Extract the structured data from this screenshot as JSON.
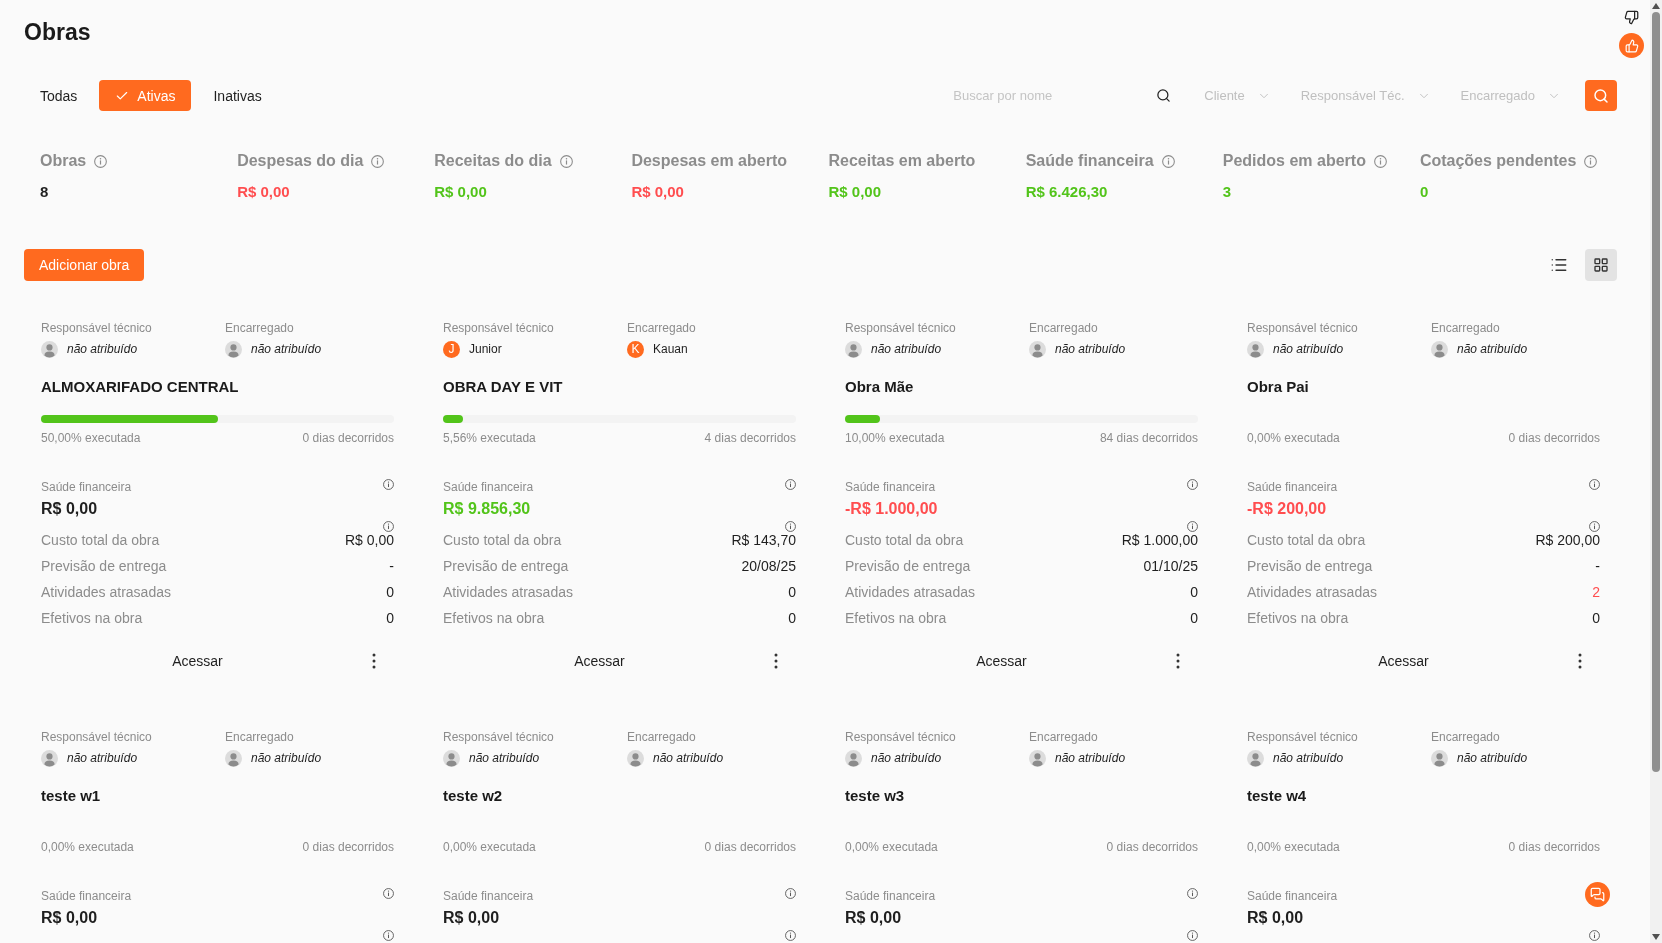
{
  "page": {
    "title": "Obras"
  },
  "tabs": [
    {
      "label": "Todas",
      "selected": false
    },
    {
      "label": "Ativas",
      "selected": true
    },
    {
      "label": "Inativas",
      "selected": false
    }
  ],
  "filters": {
    "search": {
      "placeholder": "Buscar por nome"
    },
    "selects": [
      {
        "placeholder": "Cliente"
      },
      {
        "placeholder": "Responsável Téc."
      },
      {
        "placeholder": "Encarregado"
      }
    ]
  },
  "stats": [
    {
      "label": "Obras",
      "info": true,
      "value": "8",
      "color": "#1f1f1f"
    },
    {
      "label": "Despesas do dia",
      "info": true,
      "value": "R$ 0,00",
      "color": "#ff4d4f"
    },
    {
      "label": "Receitas do dia",
      "info": true,
      "value": "R$ 0,00",
      "color": "#52c41a"
    },
    {
      "label": "Despesas em aberto",
      "info": false,
      "value": "R$ 0,00",
      "color": "#ff4d4f"
    },
    {
      "label": "Receitas em aberto",
      "info": false,
      "value": "R$ 0,00",
      "color": "#52c41a"
    },
    {
      "label": "Saúde financeira",
      "info": true,
      "value": "R$ 6.426,30",
      "color": "#52c41a"
    },
    {
      "label": "Pedidos em aberto",
      "info": true,
      "value": "3",
      "color": "#52c41a"
    },
    {
      "label": "Cotações pendentes",
      "info": true,
      "value": "0",
      "color": "#52c41a"
    }
  ],
  "add_button": "Adicionar obra",
  "view_modes": [
    {
      "kind": "list",
      "selected": false
    },
    {
      "kind": "grid",
      "selected": true
    }
  ],
  "cards": [
    {
      "responsible": {
        "label": "Responsável técnico",
        "kind": "none",
        "name": "não atribuído"
      },
      "foreman": {
        "label": "Encarregado",
        "kind": "none",
        "name": "não atribuído"
      },
      "title": "ALMOXARIFADO CENTRAL",
      "progress": {
        "level": 0.5,
        "label": "50,00% executada"
      },
      "elapsed": "0 dias decorridos",
      "health": {
        "label": "Saúde financeira",
        "info": true,
        "value": "R$ 0,00",
        "color": "#1f1f1f"
      },
      "details": [
        {
          "label": "Custo total da obra",
          "value": "R$ 0,00",
          "color": "#1f1f1f"
        },
        {
          "label": "Previsão de entrega",
          "value": "-",
          "color": "#1f1f1f"
        },
        {
          "label": "Atividades atrasadas",
          "value": "0",
          "color": "#1f1f1f"
        },
        {
          "label": "Efetivos na obra",
          "value": "0",
          "color": "#1f1f1f"
        }
      ],
      "action": "Acessar"
    },
    {
      "responsible": {
        "label": "Responsável técnico",
        "kind": "user",
        "initial": "J",
        "name": "Junior"
      },
      "foreman": {
        "label": "Encarregado",
        "kind": "user",
        "initial": "K",
        "name": "Kauan"
      },
      "title": "OBRA DAY E VIT",
      "progress": {
        "level": 0.0556,
        "label": "5,56% executada"
      },
      "elapsed": "4 dias decorridos",
      "health": {
        "label": "Saúde financeira",
        "info": true,
        "value": "R$ 9.856,30",
        "color": "#52c41a"
      },
      "details": [
        {
          "label": "Custo total da obra",
          "value": "R$ 143,70",
          "color": "#1f1f1f"
        },
        {
          "label": "Previsão de entrega",
          "value": "20/08/25",
          "color": "#1f1f1f"
        },
        {
          "label": "Atividades atrasadas",
          "value": "0",
          "color": "#1f1f1f"
        },
        {
          "label": "Efetivos na obra",
          "value": "0",
          "color": "#1f1f1f"
        }
      ],
      "action": "Acessar"
    },
    {
      "responsible": {
        "label": "Responsável técnico",
        "kind": "none",
        "name": "não atribuído"
      },
      "foreman": {
        "label": "Encarregado",
        "kind": "none",
        "name": "não atribuído"
      },
      "title": "Obra Mãe",
      "progress": {
        "level": 0.1,
        "label": "10,00% executada"
      },
      "elapsed": "84 dias decorridos",
      "health": {
        "label": "Saúde financeira",
        "info": true,
        "value": "-R$ 1.000,00",
        "color": "#ff4d4f"
      },
      "details": [
        {
          "label": "Custo total da obra",
          "value": "R$ 1.000,00",
          "color": "#1f1f1f"
        },
        {
          "label": "Previsão de entrega",
          "value": "01/10/25",
          "color": "#1f1f1f"
        },
        {
          "label": "Atividades atrasadas",
          "value": "0",
          "color": "#1f1f1f"
        },
        {
          "label": "Efetivos na obra",
          "value": "0",
          "color": "#1f1f1f"
        }
      ],
      "action": "Acessar"
    },
    {
      "responsible": {
        "label": "Responsável técnico",
        "kind": "none",
        "name": "não atribuído"
      },
      "foreman": {
        "label": "Encarregado",
        "kind": "none",
        "name": "não atribuído"
      },
      "title": "Obra Pai",
      "progress": {
        "label": "0,00% executada"
      },
      "elapsed": "0 dias decorridos",
      "health": {
        "label": "Saúde financeira",
        "info": true,
        "value": "-R$ 200,00",
        "color": "#ff4d4f"
      },
      "details": [
        {
          "label": "Custo total da obra",
          "value": "R$ 200,00",
          "color": "#1f1f1f"
        },
        {
          "label": "Previsão de entrega",
          "value": "-",
          "color": "#1f1f1f"
        },
        {
          "label": "Atividades atrasadas",
          "value": "2",
          "color": "#ff4d4f"
        },
        {
          "label": "Efetivos na obra",
          "value": "0",
          "color": "#1f1f1f"
        }
      ],
      "action": "Acessar"
    },
    {
      "responsible": {
        "label": "Responsável técnico",
        "kind": "none",
        "name": "não atribuído"
      },
      "foreman": {
        "label": "Encarregado",
        "kind": "none",
        "name": "não atribuído"
      },
      "title": "teste w1",
      "progress": {
        "label": "0,00% executada"
      },
      "elapsed": "0 dias decorridos",
      "health": {
        "label": "Saúde financeira",
        "info": true,
        "value": "R$ 0,00",
        "color": "#1f1f1f"
      }
    },
    {
      "responsible": {
        "label": "Responsável técnico",
        "kind": "none",
        "name": "não atribuído"
      },
      "foreman": {
        "label": "Encarregado",
        "kind": "none",
        "name": "não atribuído"
      },
      "title": "teste w2",
      "progress": {
        "label": "0,00% executada"
      },
      "elapsed": "0 dias decorridos",
      "health": {
        "label": "Saúde financeira",
        "info": true,
        "value": "R$ 0,00",
        "color": "#1f1f1f"
      }
    },
    {
      "responsible": {
        "label": "Responsável técnico",
        "kind": "none",
        "name": "não atribuído"
      },
      "foreman": {
        "label": "Encarregado",
        "kind": "none",
        "name": "não atribuído"
      },
      "title": "teste w3",
      "progress": {
        "label": "0,00% executada"
      },
      "elapsed": "0 dias decorridos",
      "health": {
        "label": "Saúde financeira",
        "info": true,
        "value": "R$ 0,00",
        "color": "#1f1f1f"
      }
    },
    {
      "responsible": {
        "label": "Responsável técnico",
        "kind": "none",
        "name": "não atribuído"
      },
      "foreman": {
        "label": "Encarregado",
        "kind": "none",
        "name": "não atribuído"
      },
      "title": "teste w4",
      "progress": {
        "label": "0,00% executada"
      },
      "elapsed": "0 dias decorridos",
      "health": {
        "label": "Saúde financeira",
        "info": false,
        "value": "R$ 0,00",
        "color": "#1f1f1f"
      }
    }
  ]
}
